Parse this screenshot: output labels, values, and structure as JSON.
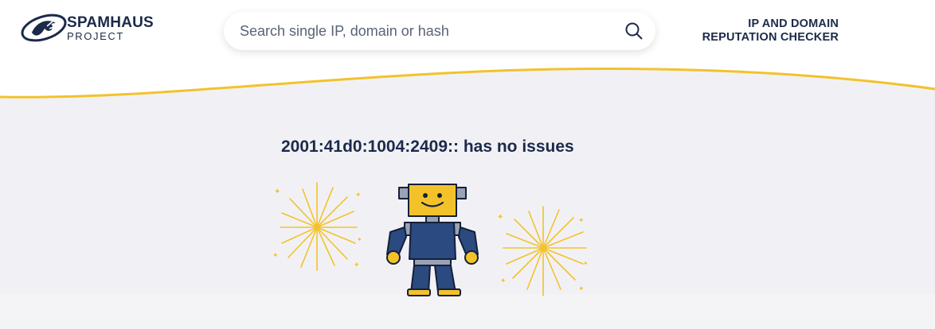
{
  "brand": {
    "name": "SPAMHAUS",
    "sub": "PROJECT",
    "logo_icon": "spamhaus-logo-icon"
  },
  "search": {
    "placeholder": "Search single IP, domain or hash",
    "value": "",
    "icon": "search-icon"
  },
  "nav": {
    "title_line1": "IP AND DOMAIN",
    "title_line2": "REPUTATION CHECKER"
  },
  "result": {
    "message": "2001:41d0:1004:2409:: has no issues",
    "illustration": "happy-robot-with-fireworks"
  },
  "colors": {
    "navy": "#1b2a4a",
    "accent_yellow": "#f3c22b",
    "background": "#f1f1f5",
    "header_background": "#ffffff"
  }
}
